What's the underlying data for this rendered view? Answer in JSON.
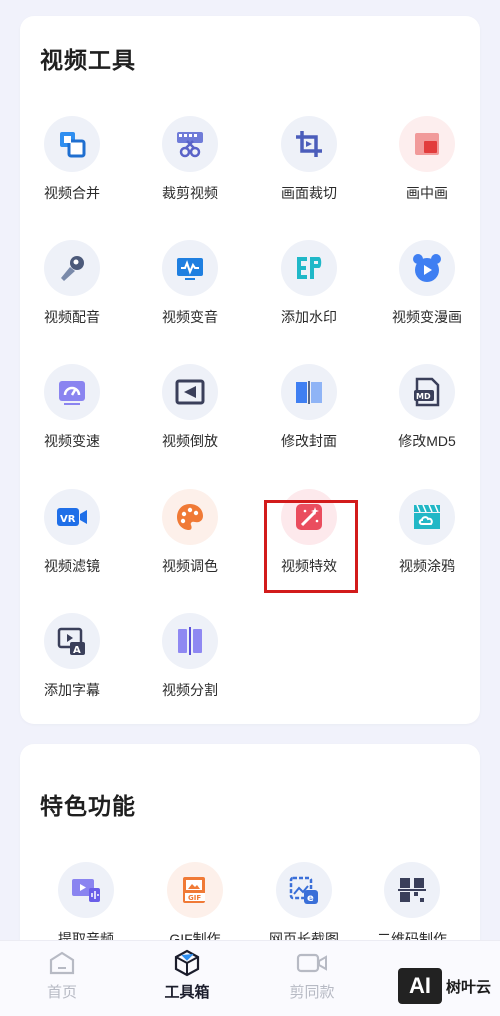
{
  "video_tools": {
    "title": "视频工具",
    "items": [
      {
        "label": "视频合并",
        "icon": "merge-icon"
      },
      {
        "label": "裁剪视频",
        "icon": "scissors-film-icon"
      },
      {
        "label": "画面裁切",
        "icon": "crop-icon"
      },
      {
        "label": "画中画",
        "icon": "picture-in-picture-icon"
      },
      {
        "label": "视频配音",
        "icon": "microphone-icon"
      },
      {
        "label": "视频变音",
        "icon": "audio-wave-icon"
      },
      {
        "label": "添加水印",
        "icon": "watermark-icon"
      },
      {
        "label": "视频变漫画",
        "icon": "bear-play-icon"
      },
      {
        "label": "视频变速",
        "icon": "speedometer-icon"
      },
      {
        "label": "视频倒放",
        "icon": "rewind-icon"
      },
      {
        "label": "修改封面",
        "icon": "book-icon"
      },
      {
        "label": "修改MD5",
        "icon": "md5-file-icon"
      },
      {
        "label": "视频滤镜",
        "icon": "vr-camera-icon"
      },
      {
        "label": "视频调色",
        "icon": "palette-icon"
      },
      {
        "label": "视频特效",
        "icon": "magic-wand-icon"
      },
      {
        "label": "视频涂鸦",
        "icon": "clapper-cloud-icon"
      },
      {
        "label": "添加字幕",
        "icon": "subtitle-icon"
      },
      {
        "label": "视频分割",
        "icon": "split-icon"
      }
    ]
  },
  "featured": {
    "title": "特色功能",
    "items": [
      {
        "label": "提取音频",
        "icon": "extract-audio-icon"
      },
      {
        "label": "GIF制作",
        "icon": "gif-icon"
      },
      {
        "label": "网页长截图",
        "icon": "web-screenshot-icon"
      },
      {
        "label": "二维码制作",
        "icon": "qr-code-icon"
      }
    ]
  },
  "highlighted_tool": "视频特效",
  "tabbar": {
    "tabs": [
      {
        "label": "首页",
        "icon": "home-icon",
        "active": false
      },
      {
        "label": "工具箱",
        "icon": "toolbox-icon",
        "active": true
      },
      {
        "label": "剪同款",
        "icon": "video-camera-icon",
        "active": false
      }
    ]
  },
  "watermark": {
    "logo_text": "AI",
    "text": "树叶云"
  },
  "colors": {
    "background": "#f1f2fb",
    "highlight": "#d21b1b",
    "active_tab": "#1b1d2c",
    "inactive_tab": "#b7bac4"
  }
}
